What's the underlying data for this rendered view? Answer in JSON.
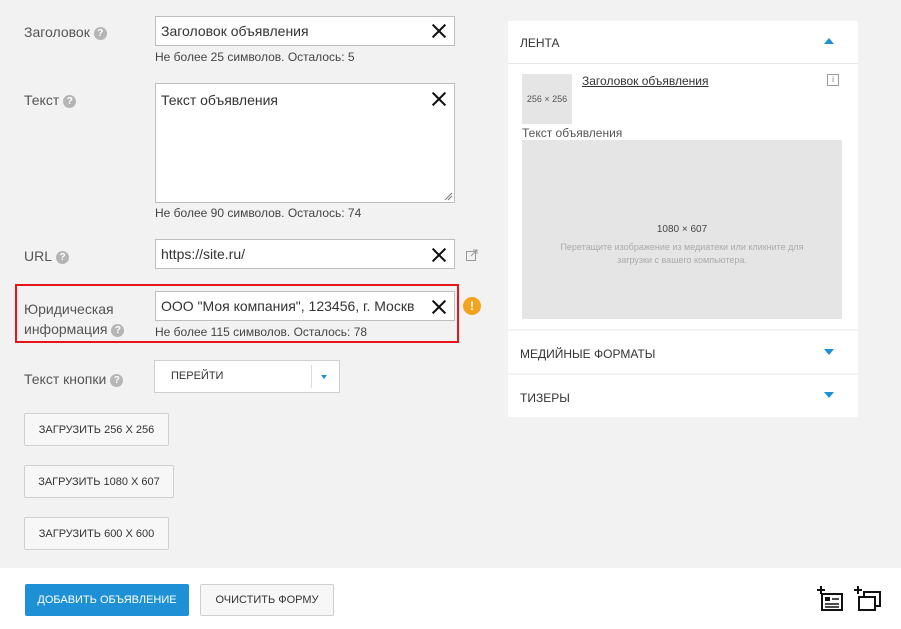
{
  "form": {
    "title": {
      "label": "Заголовок",
      "value": "Заголовок объявления",
      "hint_prefix": "Не более",
      "hint_max": "25",
      "hint_rest": "символов. Осталось: 5"
    },
    "text": {
      "label": "Текст",
      "value": "Текст объявления",
      "hint_prefix": "Не более",
      "hint_max": "90",
      "hint_rest": "символов. Осталось: 74"
    },
    "url": {
      "label": "URL",
      "value": "https://site.ru/"
    },
    "legal": {
      "label_line1": "Юридическая",
      "label_line2": "информация",
      "value": "ООО \"Моя компания\", 123456, г. Москв",
      "hint_prefix": "Не более",
      "hint_max": "115",
      "hint_rest": "символов. Осталось: 78",
      "warning_icon": "!"
    },
    "button_text": {
      "label": "Текст кнопки",
      "value": "ПЕРЕЙТИ"
    },
    "help_icon": "?",
    "uploads": [
      {
        "label": "ЗАГРУЗИТЬ 256 X 256"
      },
      {
        "label": "ЗАГРУЗИТЬ 1080 X 607"
      },
      {
        "label": "ЗАГРУЗИТЬ 600 X 600"
      }
    ]
  },
  "preview": {
    "feed": {
      "title": "ЛЕНТА",
      "thumb_size": "256 × 256",
      "headline": "Заголовок объявления",
      "info_icon": "i",
      "body_text": "Текст объявления",
      "image_size": "1080 × 607",
      "image_hint": "Перетащите изображение из медиатеки или кликните для загрузки с вашего компьютера."
    },
    "media_formats": {
      "title": "МЕДИЙНЫЕ ФОРМАТЫ"
    },
    "teasers": {
      "title": "ТИЗЕРЫ"
    }
  },
  "footer": {
    "add_label": "ДОБАВИТЬ ОБЪЯВЛЕНИЕ",
    "clear_label": "ОЧИСТИТЬ ФОРМУ"
  },
  "colors": {
    "accent": "#1e90d6",
    "highlight": "#e8141c",
    "warning": "#f2a31f"
  }
}
